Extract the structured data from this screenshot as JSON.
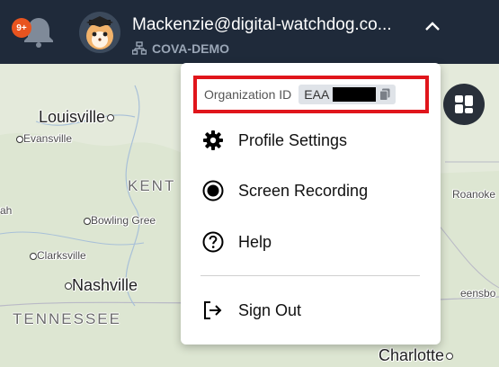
{
  "header": {
    "notification_count": "9+",
    "user_email": "Mackenzie@digital-watchdog.co...",
    "org_name": "COVA-DEMO",
    "icons": [
      "bell-icon",
      "avatar-image",
      "org-tree-icon",
      "chevron-up-icon"
    ],
    "colors": {
      "bar": "#1f2a3a",
      "badge": "#e8541f"
    }
  },
  "menu": {
    "org_id_label": "Organization ID",
    "org_id_value": "EAA",
    "items": [
      {
        "label": "Profile Settings",
        "icon": "gear-icon"
      },
      {
        "label": "Screen Recording",
        "icon": "record-icon"
      },
      {
        "label": "Help",
        "icon": "help-icon"
      },
      {
        "label": "Sign Out",
        "icon": "sign-out-icon"
      }
    ],
    "highlight_color": "#e0151b"
  },
  "map": {
    "labels": {
      "louisville": "Louisville",
      "evansville": "Evansville",
      "kentucky": "KENT",
      "ah": "ah",
      "bowling_green": "Bowling Gree",
      "clarksville": "Clarksville",
      "nashville": "Nashville",
      "tennessee": "TENNESSEE",
      "charlotte": "Charlotte",
      "roanoke": "Roanoke",
      "greensboro": "eensbo"
    }
  }
}
